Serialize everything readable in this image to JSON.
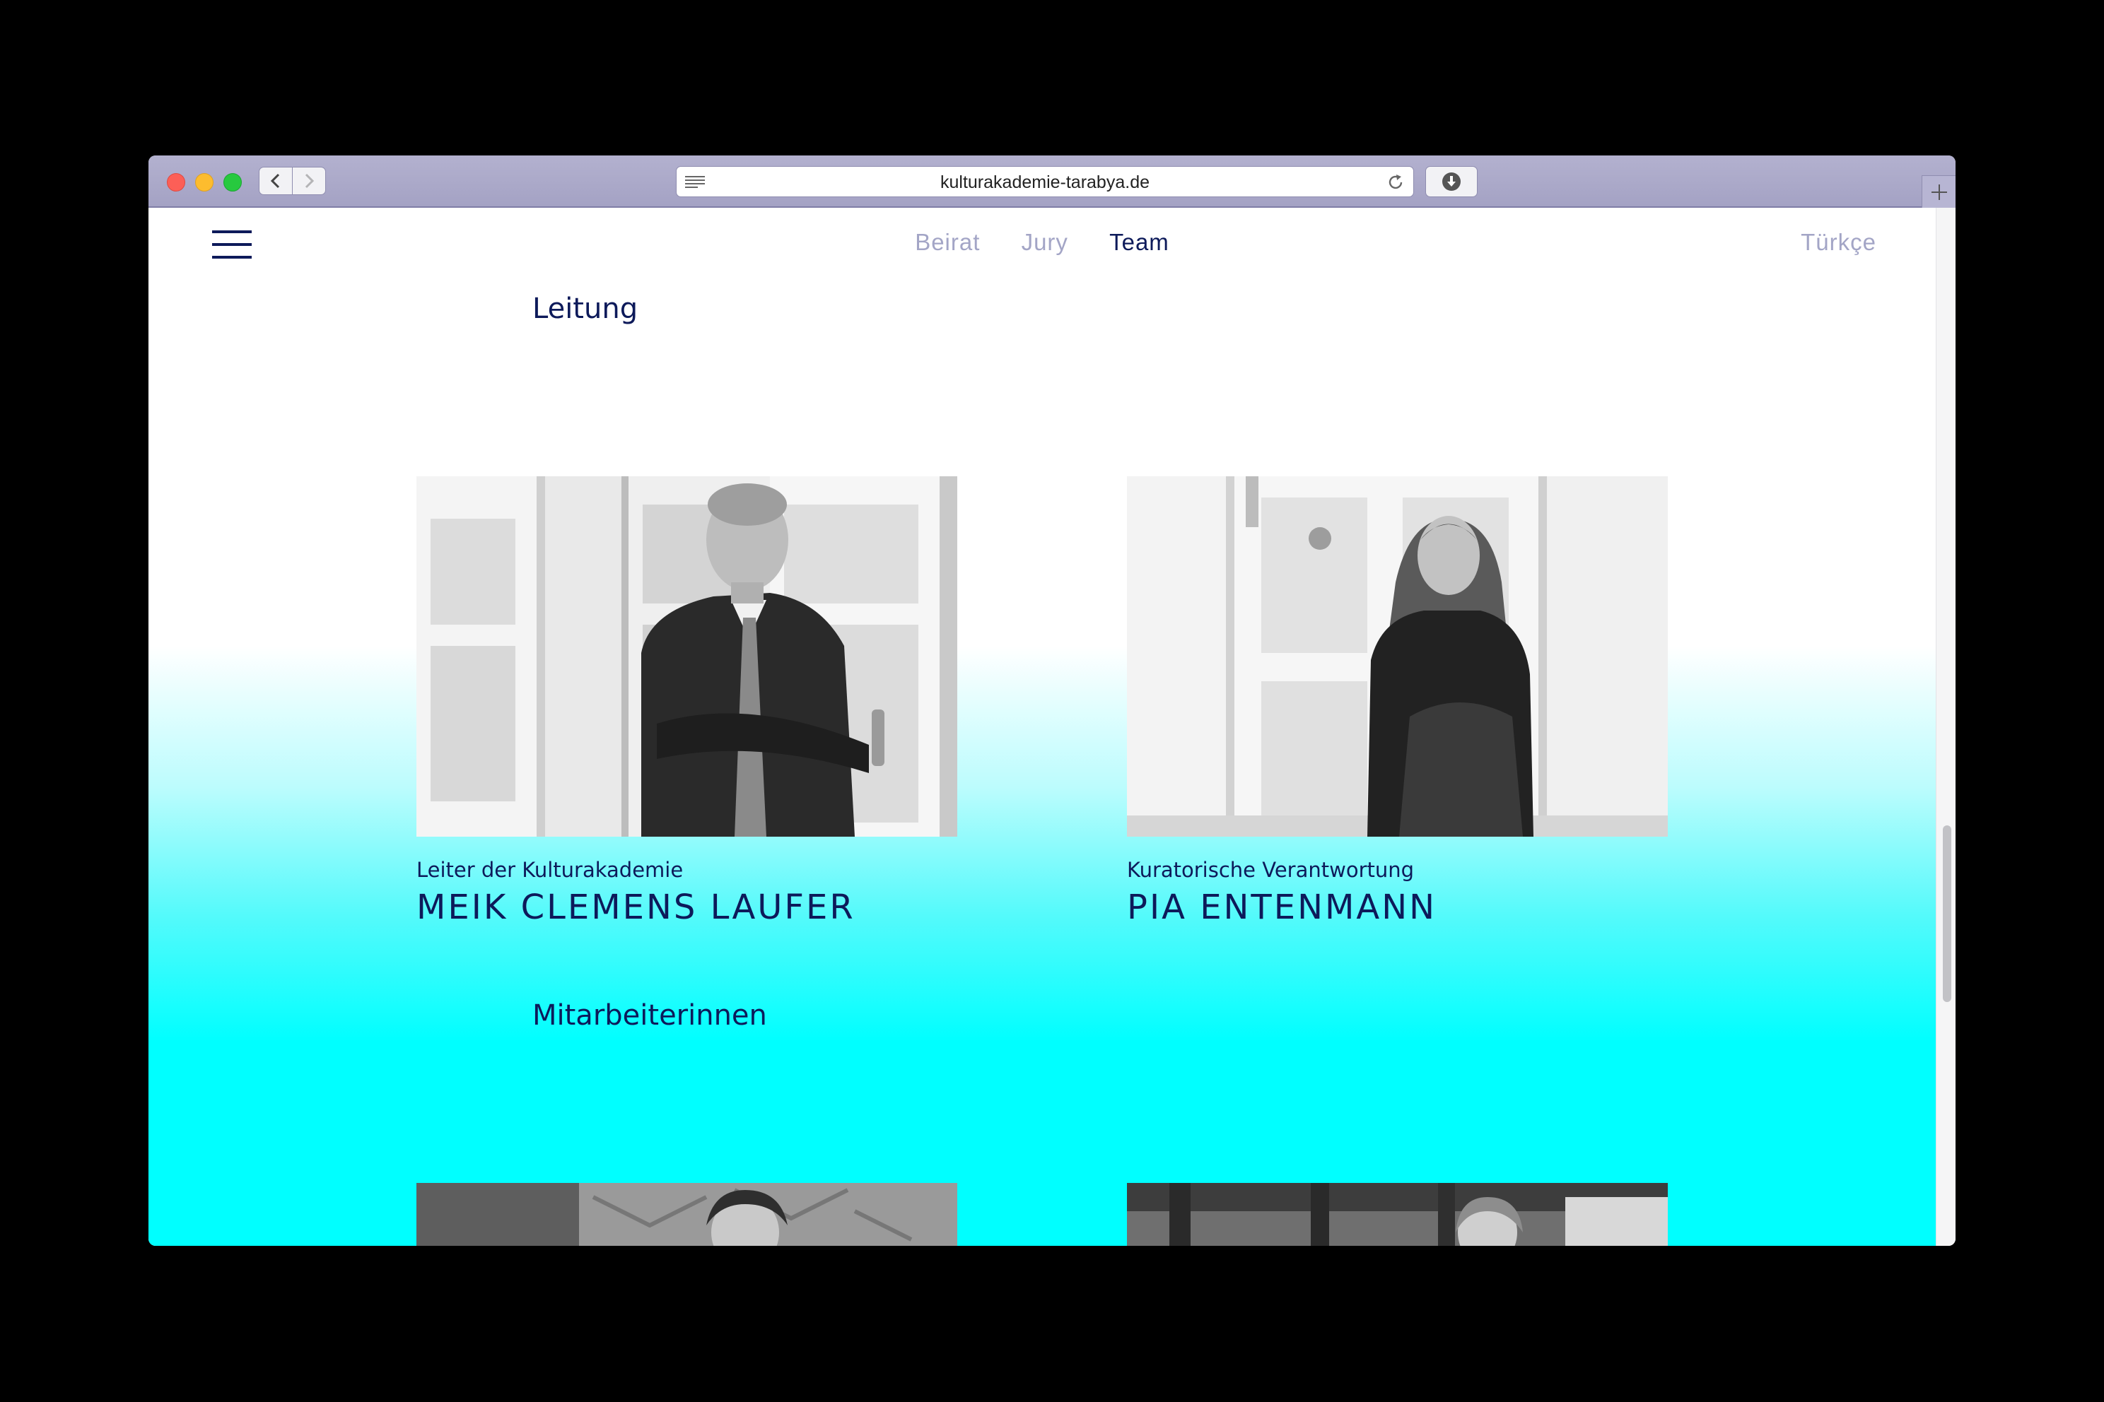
{
  "browser": {
    "url": "kulturakademie-tarabya.de"
  },
  "header": {
    "nav": [
      "Beirat",
      "Jury",
      "Team"
    ],
    "active_nav": "Team",
    "language": "Türkçe"
  },
  "sections": [
    {
      "title": "Leitung",
      "people": [
        {
          "role": "Leiter der Kulturakademie",
          "name": "MEIK CLEMENS LAUFER"
        },
        {
          "role": "Kuratorische Verantwortung",
          "name": "PIA ENTENMANN"
        }
      ]
    },
    {
      "title": "Mitarbeiterinnen",
      "people": []
    }
  ],
  "colors": {
    "text_dark": "#0d1a5a",
    "nav_inactive": "#a3a5c6",
    "gradient_accent": "#00ffff"
  }
}
